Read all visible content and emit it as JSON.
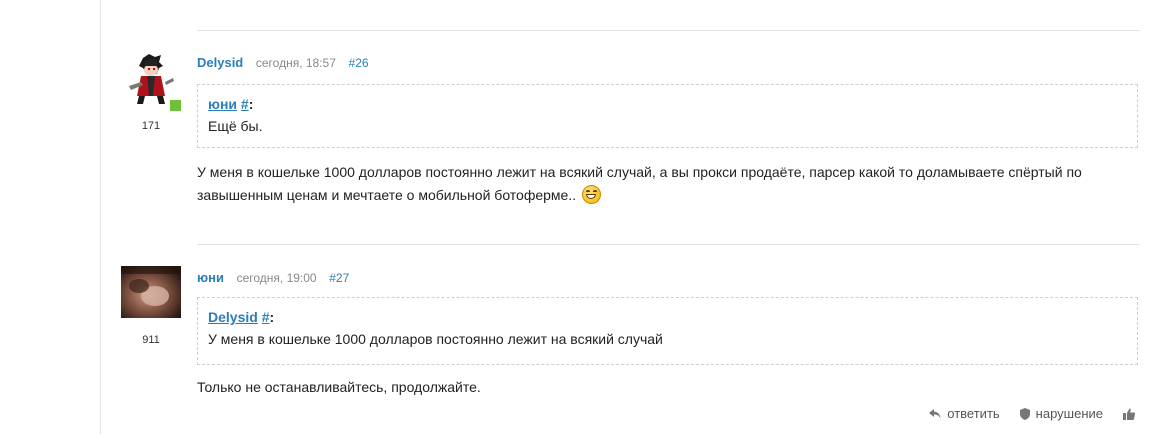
{
  "posts": [
    {
      "author": "Delysid",
      "date": "сегодня, 18:57",
      "number": "#26",
      "reputation": "171",
      "online": true,
      "quote": {
        "author": "юни",
        "link": "#",
        "colon": ":",
        "text": "Ещё бы."
      },
      "body": "У меня в кошельке 1000 долларов постоянно лежит на всякий случай, а вы прокси продаёте, парсер какой то доламываете спёртый по завышенным ценам и мечтаете о мобильной ботоферме.."
    },
    {
      "author": "юни",
      "date": "сегодня, 19:00",
      "number": "#27",
      "reputation": "911",
      "quote": {
        "author": "Delysid",
        "link": "#",
        "colon": ":",
        "text": "У меня в кошельке 1000 долларов постоянно лежит на всякий случай"
      },
      "body": "Только не останавливайтесь, продолжайте."
    }
  ],
  "actions": {
    "reply": "ответить",
    "report": "нарушение"
  },
  "colors": {
    "link": "#2a7fb8",
    "online": "#6fbf3a"
  },
  "icons": {
    "reply": "reply-arrow-icon",
    "report": "shield-icon",
    "like": "thumbs-up-icon",
    "emoji": "laughing-emoji-icon"
  }
}
